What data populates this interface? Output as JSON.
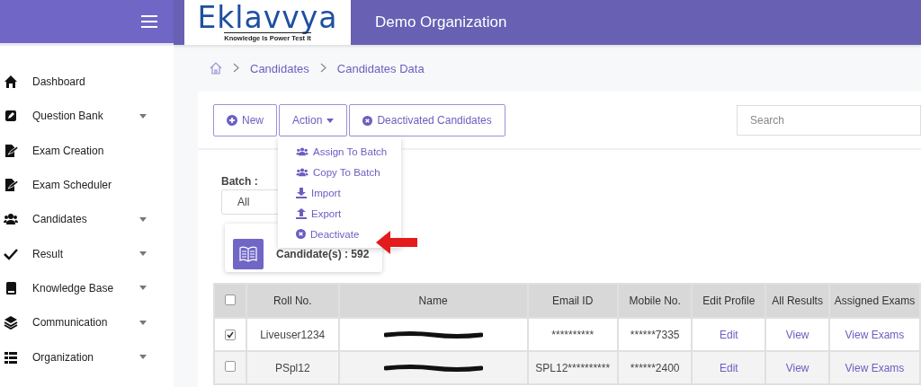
{
  "sidebar": {
    "items": [
      {
        "label": "Dashboard",
        "has_submenu": false
      },
      {
        "label": "Question Bank",
        "has_submenu": true
      },
      {
        "label": "Exam Creation",
        "has_submenu": false
      },
      {
        "label": "Exam Scheduler",
        "has_submenu": false
      },
      {
        "label": "Candidates",
        "has_submenu": true
      },
      {
        "label": "Result",
        "has_submenu": true
      },
      {
        "label": "Knowledge Base",
        "has_submenu": true
      },
      {
        "label": "Communication",
        "has_submenu": true
      },
      {
        "label": "Organization",
        "has_submenu": true
      }
    ]
  },
  "header": {
    "logo": {
      "name": "Eklavvya",
      "tagline": "Knowledge Is Power Test It"
    },
    "title": "Demo Organization"
  },
  "breadcrumb": [
    "Candidates",
    "Candidates Data"
  ],
  "toolbar": {
    "buttons": [
      {
        "label": "New",
        "kind": "new"
      },
      {
        "label": "Action",
        "kind": "dropdown"
      },
      {
        "label": "Deactivated Candidates",
        "kind": "deactivated"
      }
    ],
    "search": {
      "placeholder": "Search"
    }
  },
  "action_menu": {
    "items": [
      {
        "label": "Assign To Batch",
        "kind": "users"
      },
      {
        "label": "Copy To Batch",
        "kind": "users"
      },
      {
        "label": "Import",
        "kind": "download"
      },
      {
        "label": "Export",
        "kind": "upload"
      },
      {
        "label": "Deactivate",
        "kind": "remove"
      }
    ]
  },
  "batch": {
    "label": "Batch :",
    "value": "All"
  },
  "stat_card": {
    "text": "Candidate(s) : 592"
  },
  "table": {
    "header_checked": false,
    "columns": [
      "Roll No.",
      "Name",
      "Email ID",
      "Mobile No.",
      "Edit Profile",
      "All Results",
      "Assigned Exams"
    ],
    "rows": [
      {
        "checked": true,
        "roll_no": "Liveuser1234",
        "email": "**********",
        "mobile": "******7335",
        "edit": "Edit",
        "results": "View",
        "exams": "View Exams"
      },
      {
        "checked": false,
        "roll_no": "PSpl12",
        "email": "SPL12**********",
        "mobile": "******2400",
        "edit": "Edit",
        "results": "View",
        "exams": "View Exams"
      }
    ]
  }
}
